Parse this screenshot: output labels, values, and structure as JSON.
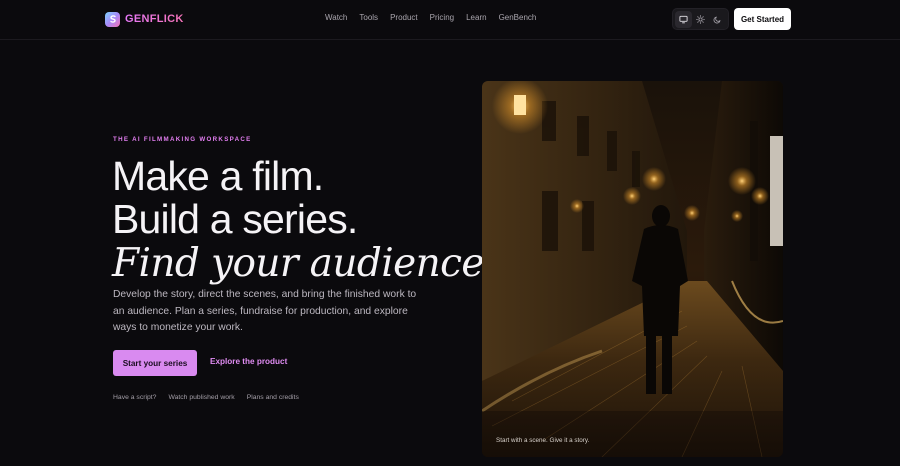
{
  "brand": {
    "name": "GENFLICK"
  },
  "nav": {
    "links": [
      "Watch",
      "Tools",
      "Product",
      "Pricing",
      "Learn",
      "GenBench"
    ],
    "cta_label": "Get Started"
  },
  "theme_toggle": {
    "options": [
      "desktop-icon",
      "sun-icon",
      "moon-icon"
    ],
    "active": "desktop-icon"
  },
  "hero": {
    "eyebrow": "THE AI FILMMAKING WORKSPACE",
    "line1": "Make a film.",
    "line2": "Build a series.",
    "line3": "Find your audience.",
    "description": "Develop the story, direct the scenes, and bring the finished work to an audience. Plan a series, fundraise for production, and explore ways to monetize your work.",
    "primary_cta": "Start your series",
    "secondary_cta": "Explore the product",
    "sub_links": [
      "Have a script?",
      "Watch published work",
      "Plans and credits"
    ],
    "image_caption": "Start with a scene. Give it a story."
  },
  "colors": {
    "background": "#0b0a0d",
    "accent": "#d98af0",
    "accent_text": "#e08cf2"
  }
}
